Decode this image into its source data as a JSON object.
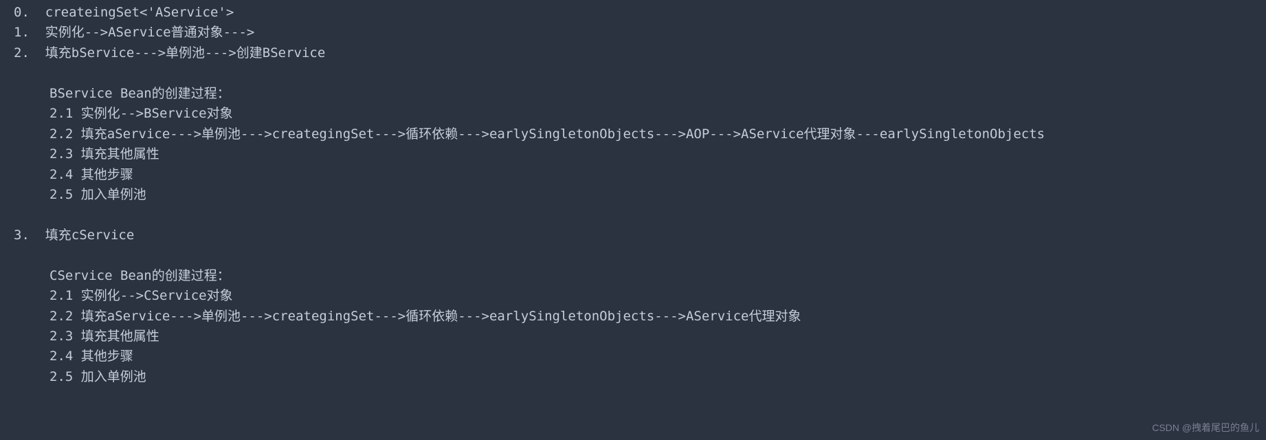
{
  "lines": {
    "l0": "0.  createingSet<'AService'>",
    "l1": "1.  实例化-->AService普通对象--->",
    "l2": "2.  填充bService--->单例池--->创建BService",
    "l3": "BService Bean的创建过程：",
    "l4": "2.1 实例化-->BService对象",
    "l5": "2.2 填充aService--->单例池--->creategingSet--->循环依赖--->earlySingletonObjects--->AOP--->AService代理对象---earlySingletonObjects",
    "l6": "2.3 填充其他属性",
    "l7": "2.4 其他步骤",
    "l8": "2.5 加入单例池",
    "l9": "3.  填充cService",
    "l10": "CService Bean的创建过程：",
    "l11": "2.1 实例化-->CService对象",
    "l12": "2.2 填充aService--->单例池--->creategingSet--->循环依赖--->earlySingletonObjects--->AService代理对象",
    "l13": "2.3 填充其他属性",
    "l14": "2.4 其他步骤",
    "l15": "2.5 加入单例池"
  },
  "watermark": "CSDN @拽着尾巴的鱼儿"
}
